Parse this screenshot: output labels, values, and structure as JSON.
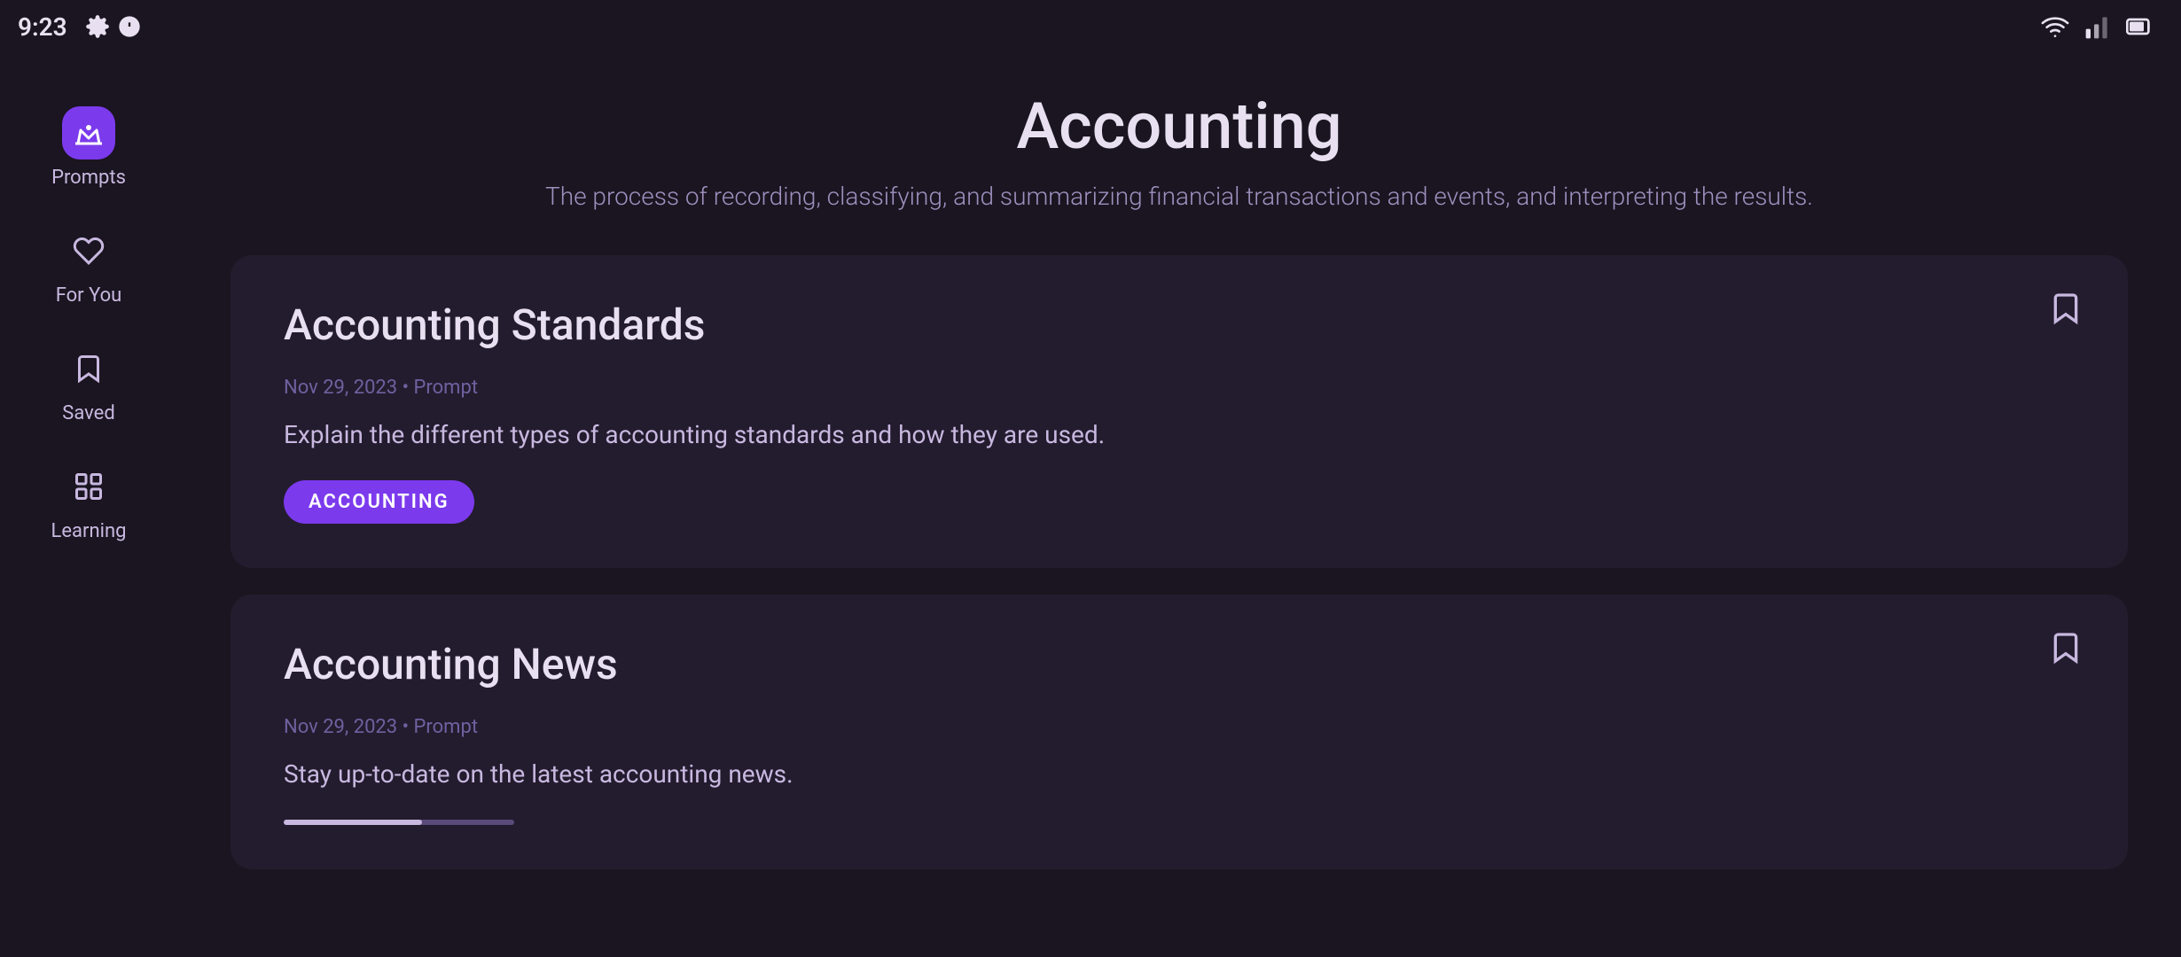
{
  "statusBar": {
    "time": "9:23",
    "icons": [
      "settings-icon",
      "accessibility-icon"
    ]
  },
  "sidebar": {
    "items": [
      {
        "id": "prompts",
        "label": "Prompts",
        "icon": "crown-icon",
        "active": true
      },
      {
        "id": "for-you",
        "label": "For You",
        "icon": "heart-icon",
        "active": false
      },
      {
        "id": "saved",
        "label": "Saved",
        "icon": "bookmark-icon",
        "active": false
      },
      {
        "id": "learning",
        "label": "Learning",
        "icon": "grid-icon",
        "active": false
      }
    ]
  },
  "page": {
    "title": "Accounting",
    "subtitle": "The process of recording, classifying, and summarizing financial transactions and events, and interpreting the results."
  },
  "cards": [
    {
      "id": "accounting-standards",
      "title": "Accounting Standards",
      "meta": "Nov 29, 2023 • Prompt",
      "description": "Explain the different types of accounting standards and how they are used.",
      "tag": "ACCOUNTING",
      "bookmarked": false
    },
    {
      "id": "accounting-news",
      "title": "Accounting News",
      "meta": "Nov 29, 2023 • Prompt",
      "description": "Stay up-to-date on the latest accounting news.",
      "tag": null,
      "bookmarked": false,
      "hasProgress": true
    }
  ]
}
